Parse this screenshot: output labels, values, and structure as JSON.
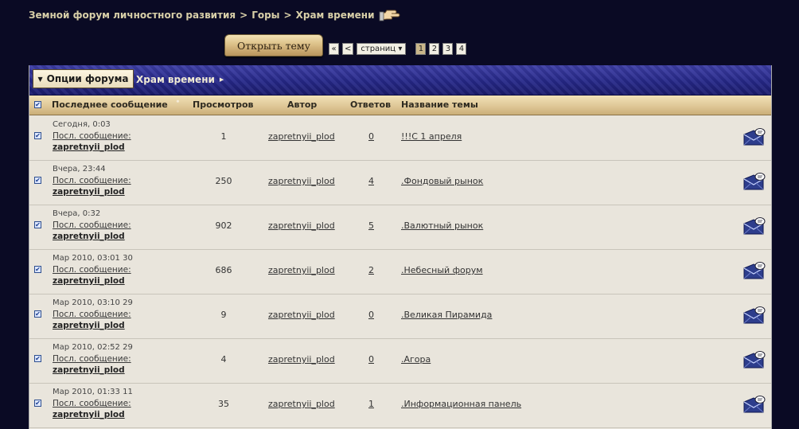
{
  "breadcrumb": {
    "items": [
      "Земной форум личностного развития",
      "Горы",
      "Храм времени"
    ],
    "sep": ">"
  },
  "toolbar": {
    "open_topic": "Открыть тему"
  },
  "pager": {
    "first": "«",
    "prev": "<",
    "select_label": "страниц",
    "pages": [
      "1",
      "2",
      "3",
      "4"
    ],
    "current": "1"
  },
  "panel": {
    "options_label": "Опции форума",
    "forum_title": "Храм времени"
  },
  "columns": {
    "last": "Последнее сообщение",
    "views": "Просмотров",
    "author": "Автор",
    "replies": "Ответов",
    "topic": "Название темы"
  },
  "rows": [
    {
      "when": "Сегодня, 0:03",
      "last_link": "Посл. сообщение:",
      "last_user": "zapretnyii_plod",
      "views": "1",
      "author": "zapretnyii_plod",
      "replies": "0",
      "topic": "!!!С 1 апреля"
    },
    {
      "when": "Вчера, 23:44",
      "last_link": "Посл. сообщение:",
      "last_user": "zapretnyii_plod",
      "views": "250",
      "author": "zapretnyii_plod",
      "replies": "4",
      "topic": ".Фондовый рынок"
    },
    {
      "when": "Вчера, 0:32",
      "last_link": "Посл. сообщение:",
      "last_user": "zapretnyii_plod",
      "views": "902",
      "author": "zapretnyii_plod",
      "replies": "5",
      "topic": ".Валютный рынок"
    },
    {
      "when": "Мар 2010, 03:01 30",
      "last_link": "Посл. сообщение:",
      "last_user": "zapretnyii_plod",
      "views": "686",
      "author": "zapretnyii_plod",
      "replies": "2",
      "topic": ".Небесный форум"
    },
    {
      "when": "Мар 2010, 03:10 29",
      "last_link": "Посл. сообщение:",
      "last_user": "zapretnyii_plod",
      "views": "9",
      "author": "zapretnyii_plod",
      "replies": "0",
      "topic": ".Великая Пирамида"
    },
    {
      "when": "Мар 2010, 02:52 29",
      "last_link": "Посл. сообщение:",
      "last_user": "zapretnyii_plod",
      "views": "4",
      "author": "zapretnyii_plod",
      "replies": "0",
      "topic": ".Агора"
    },
    {
      "when": "Мар 2010, 01:33 11",
      "last_link": "Посл. сообщение:",
      "last_user": "zapretnyii_plod",
      "views": "35",
      "author": "zapretnyii_plod",
      "replies": "1",
      "topic": ".Информационная панель"
    }
  ],
  "icons": {
    "breadcrumb_end": "pointing-hand-icon",
    "row_action": "new-message-envelope-icon",
    "checkbox": "checkbox-checked-icon"
  }
}
